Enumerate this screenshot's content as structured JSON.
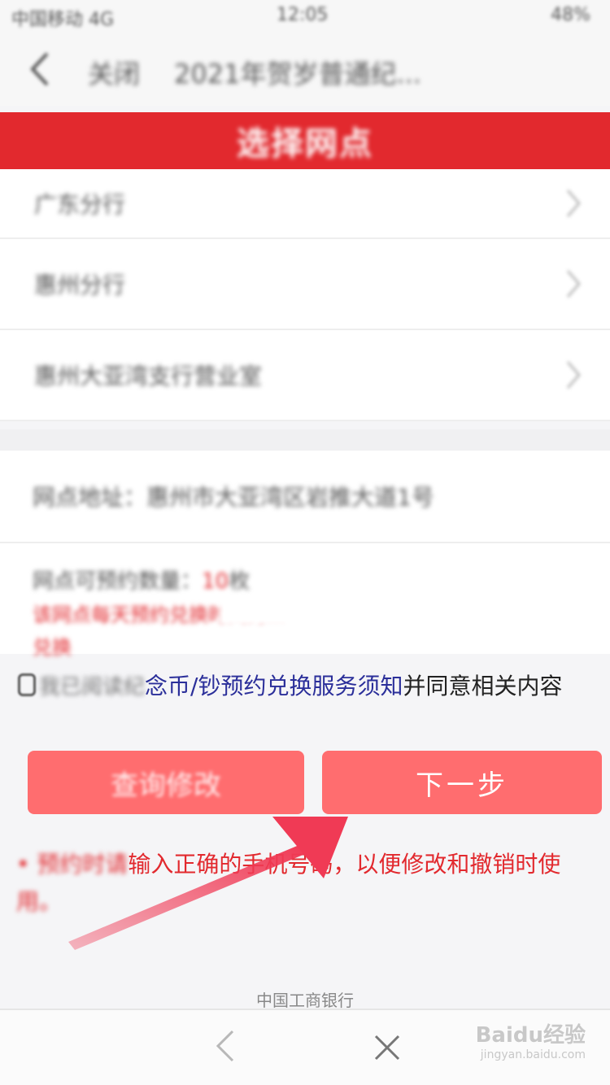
{
  "status_bar": {
    "carrier": "中国移动 4G",
    "time": "12:05",
    "battery": "48%"
  },
  "nav": {
    "close_label": "关闭",
    "title": "2021年贺岁普通纪..."
  },
  "banner": {
    "title": "选择网点"
  },
  "list": {
    "items": [
      {
        "label": "广东分行"
      },
      {
        "label": "惠州分行"
      },
      {
        "label": "惠州大亚湾支行营业室"
      }
    ]
  },
  "info": {
    "address_label": "网点地址：",
    "address_value": "惠州市大亚湾区岩推大道1号",
    "quantity_label": "网点可预约数量：",
    "quantity_value": "10",
    "quantity_unit": "枚",
    "warning_line1": "该网点每天预约兑换时间为...",
    "warning_line2": "兑换"
  },
  "agreement": {
    "prefix": "我已阅读纪",
    "link": "念币/钞预约兑换服务须知",
    "suffix": "并同意相关内容"
  },
  "buttons": {
    "query_label": "查询修改",
    "next_label": "下一步"
  },
  "notice": {
    "blurred_prefix": "• 预约时请",
    "text_line1": "输入正确的手机号码，以便修改和撤销时使",
    "text_line2": "用。"
  },
  "footer": {
    "text": "中国工商银行"
  },
  "watermark": {
    "main": "Baidu经验",
    "sub": "jingyan.baidu.com"
  },
  "colors": {
    "brand_red": "#e2292e",
    "button": "#ff6d6f",
    "link": "#2b2f9a",
    "arrow": "#f03a55"
  }
}
